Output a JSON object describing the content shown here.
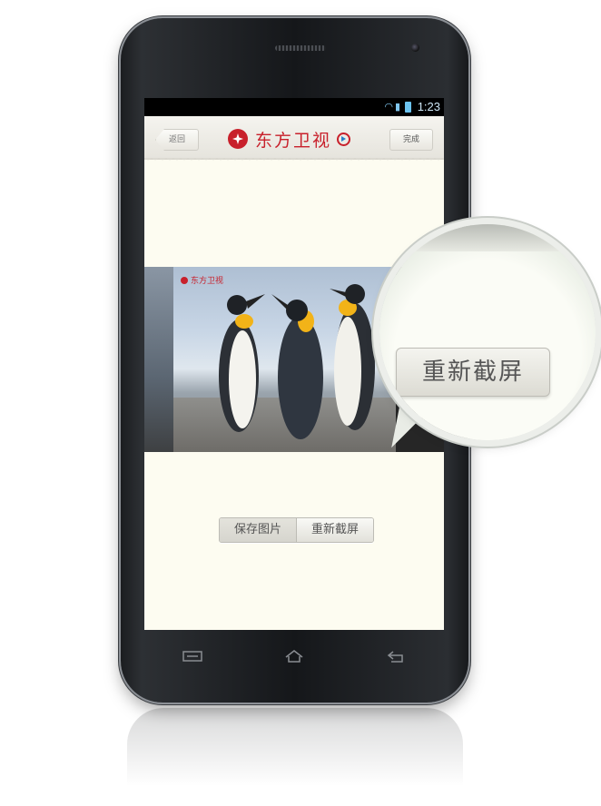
{
  "status_bar": {
    "time": "1:23",
    "icons": [
      "wifi-icon",
      "signal-icon",
      "battery-icon"
    ]
  },
  "header": {
    "back_label": "返回",
    "title": "东方卫视",
    "done_label": "完成"
  },
  "screenshot_preview": {
    "watermark": "东方卫视"
  },
  "actions": {
    "save_label": "保存图片",
    "retake_label": "重新截屏"
  },
  "magnifier": {
    "button_label": "重新截屏"
  },
  "nav_keys": [
    "menu-icon",
    "home-icon",
    "back-icon"
  ],
  "colors": {
    "brand_red": "#c8202b",
    "screen_bg": "#fdfcf1",
    "status_blue": "#6cc3ef"
  }
}
